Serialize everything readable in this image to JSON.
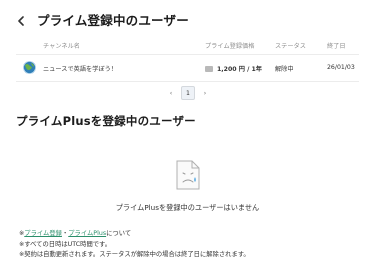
{
  "header": {
    "title": "プライム登録中のユーザー"
  },
  "table": {
    "columns": [
      "チャンネル名",
      "プライム登録価格",
      "ステータス",
      "終了日"
    ],
    "rows": [
      {
        "channel": "ニュースで英語を学ぼう！",
        "price": "1,200 円 / 1年",
        "status": "解除中",
        "end_date": "26/01/03"
      }
    ]
  },
  "pagination": {
    "prev": "‹",
    "current": "1",
    "next": "›"
  },
  "plus_section": {
    "title": "プライムPlusを登録中のユーザー",
    "empty_message": "プライムPlusを登録中のユーザーはいません"
  },
  "notes": {
    "prefix": "※",
    "link1": "プライム登録",
    "separator": "・",
    "link2": "プライムPlus",
    "suffix": "について",
    "line2": "※すべての日時はUTC時間です。",
    "line3": "※契約は自動更新されます。ステータスが解除中の場合は終了日に解除されます。"
  },
  "colors": {
    "link": "#2a8f6a",
    "muted": "#8e8e8e",
    "page_active_bg": "#eef2f7"
  }
}
